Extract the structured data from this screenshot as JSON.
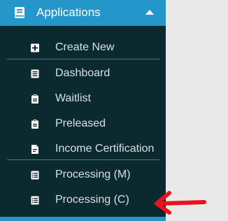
{
  "header": {
    "title": "Applications",
    "icon": "book-icon",
    "chevron_icon": "chevron-up-icon"
  },
  "menu": {
    "items": [
      {
        "label": "Create New",
        "icon": "plus-square-icon"
      },
      {
        "label": "Dashboard",
        "icon": "list-icon"
      },
      {
        "label": "Waitlist",
        "icon": "clipboard-icon"
      },
      {
        "label": "Preleased",
        "icon": "clipboard-icon"
      },
      {
        "label": "Income Certification",
        "icon": "file-icon"
      },
      {
        "label": "Processing (M)",
        "icon": "list-icon"
      },
      {
        "label": "Processing (C)",
        "icon": "list-icon"
      }
    ]
  },
  "colors": {
    "sidebar_bg": "#0b2a2f",
    "header_bg": "#2596c9",
    "text": "#d6e0e2",
    "arrow": "#e8131b",
    "page_bg": "#e9e9e9"
  }
}
